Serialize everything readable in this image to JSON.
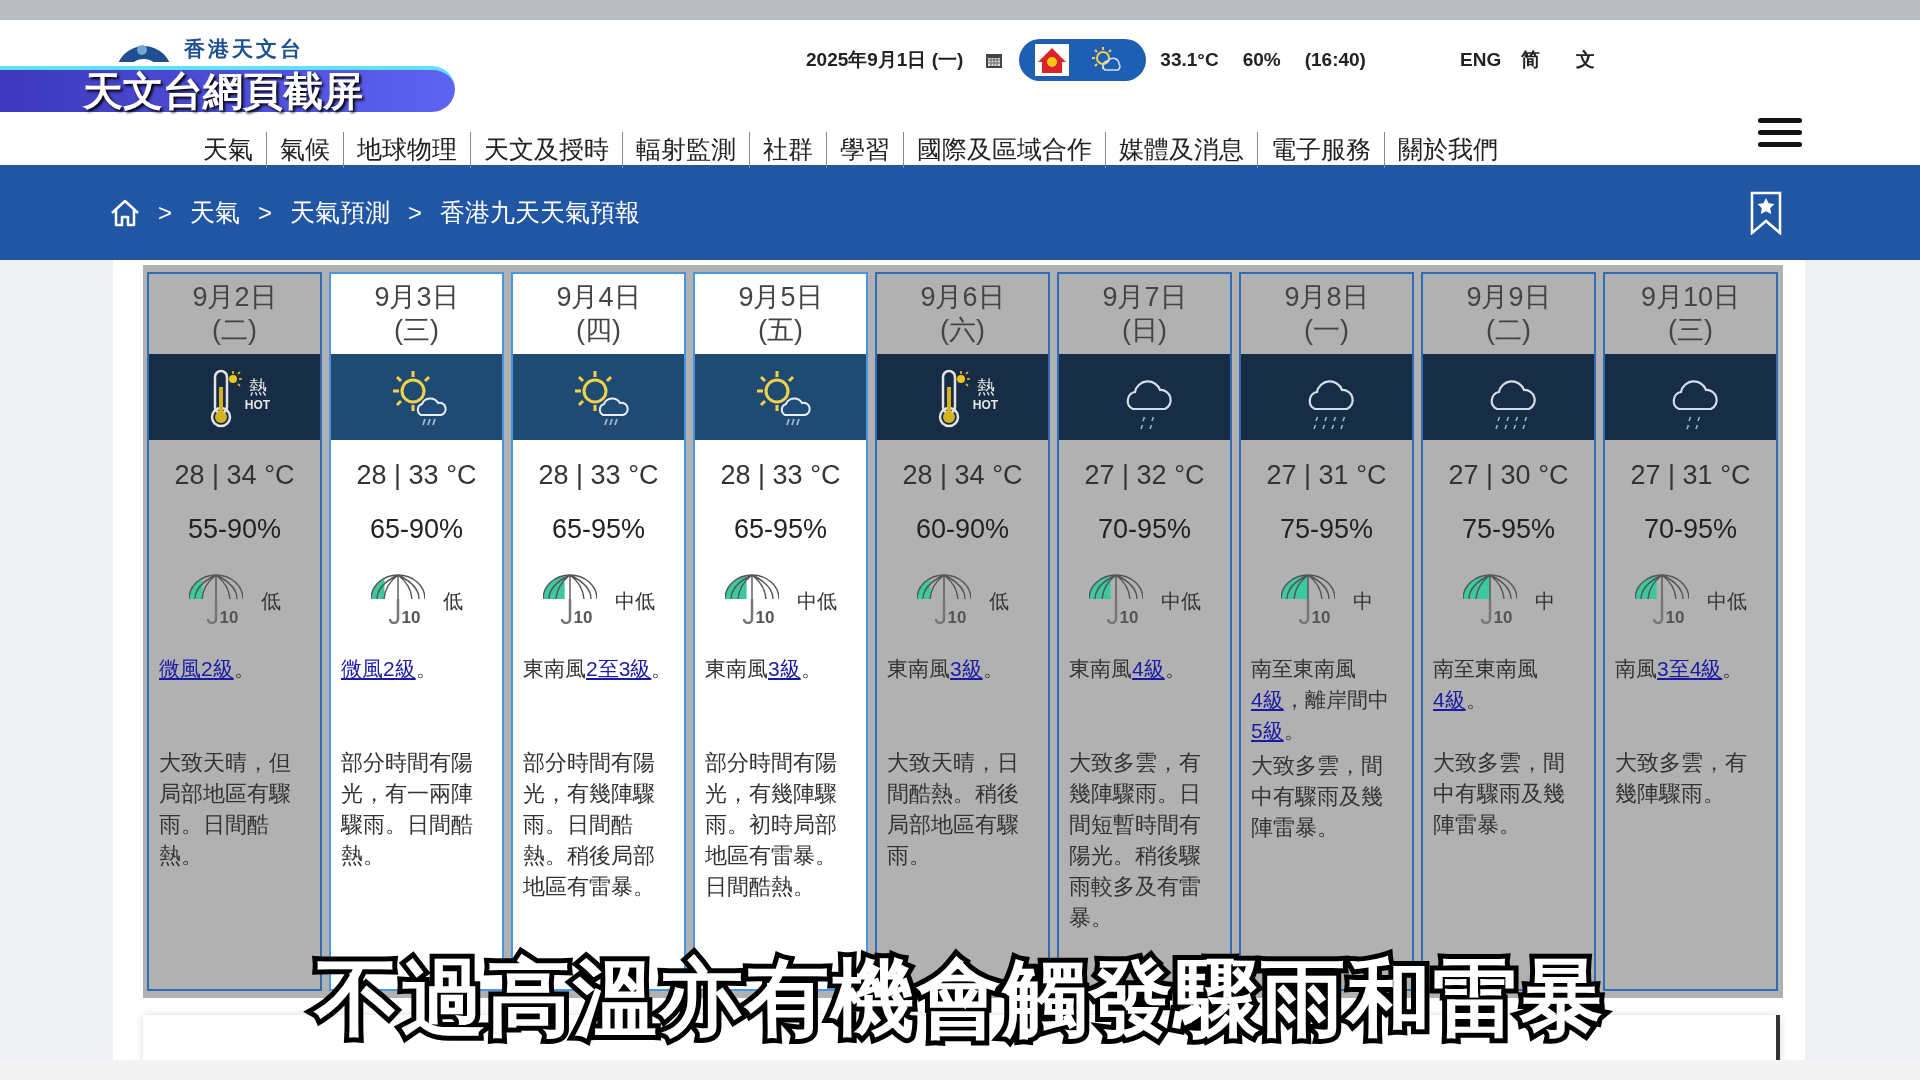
{
  "header": {
    "logo_text": "香港天文台",
    "date": "2025年9月1日 (一)",
    "temperature": "33.1°C",
    "humidity": "60%",
    "time": "(16:40)",
    "languages": [
      "ENG",
      "简",
      "文"
    ]
  },
  "nav": [
    "天氣",
    "氣候",
    "地球物理",
    "天文及授時",
    "輻射監測",
    "社群",
    "學習",
    "國際及區域合作",
    "媒體及消息",
    "電子服務",
    "關於我們"
  ],
  "breadcrumb": [
    {
      "kind": "home"
    },
    {
      "kind": "sep",
      "text": ">"
    },
    {
      "kind": "link",
      "text": "天氣"
    },
    {
      "kind": "sep",
      "text": ">"
    },
    {
      "kind": "link",
      "text": "天氣預測"
    },
    {
      "kind": "sep",
      "text": ">"
    },
    {
      "kind": "link",
      "text": "香港九天天氣預報"
    }
  ],
  "forecast": [
    {
      "date": "9月2日",
      "weekday": "(二)",
      "highlighted": false,
      "icon": {
        "kind": "hot",
        "label": "熱",
        "label_en": "HOT"
      },
      "temperature": "28 | 34 °C",
      "humidity": "55-90%",
      "psr": {
        "level": 0.25,
        "number": "10",
        "label": "低"
      },
      "wind": [
        {
          "text": "微風2級",
          "link": true
        },
        {
          "text": "。",
          "link": false
        }
      ],
      "description": "大致天晴，但局部地區有驟雨。日間酷熱。"
    },
    {
      "date": "9月3日",
      "weekday": "(三)",
      "highlighted": true,
      "icon": {
        "kind": "sun-shower"
      },
      "temperature": "28 | 33 °C",
      "humidity": "65-90%",
      "psr": {
        "level": 0.25,
        "number": "10",
        "label": "低"
      },
      "wind": [
        {
          "text": "微風2級",
          "link": true
        },
        {
          "text": "。",
          "link": false
        }
      ],
      "description": "部分時間有陽光，有一兩陣驟雨。日間酷熱。"
    },
    {
      "date": "9月4日",
      "weekday": "(四)",
      "highlighted": true,
      "icon": {
        "kind": "sun-shower"
      },
      "temperature": "28 | 33 °C",
      "humidity": "65-95%",
      "psr": {
        "level": 0.4,
        "number": "10",
        "label": "中低"
      },
      "wind": [
        {
          "text": "東南風",
          "link": false
        },
        {
          "text": "2至3級",
          "link": true
        },
        {
          "text": "。",
          "link": false
        }
      ],
      "description": "部分時間有陽光，有幾陣驟雨。日間酷熱。稍後局部地區有雷暴。"
    },
    {
      "date": "9月5日",
      "weekday": "(五)",
      "highlighted": true,
      "icon": {
        "kind": "sun-shower"
      },
      "temperature": "28 | 33 °C",
      "humidity": "65-95%",
      "psr": {
        "level": 0.4,
        "number": "10",
        "label": "中低"
      },
      "wind": [
        {
          "text": "東南風",
          "link": false
        },
        {
          "text": "3級",
          "link": true
        },
        {
          "text": "。",
          "link": false
        }
      ],
      "description": "部分時間有陽光，有幾陣驟雨。初時局部地區有雷暴。日間酷熱。"
    },
    {
      "date": "9月6日",
      "weekday": "(六)",
      "highlighted": false,
      "icon": {
        "kind": "hot",
        "label": "熱",
        "label_en": "HOT"
      },
      "temperature": "28 | 34 °C",
      "humidity": "60-90%",
      "psr": {
        "level": 0.25,
        "number": "10",
        "label": "低"
      },
      "wind": [
        {
          "text": "東南風",
          "link": false
        },
        {
          "text": "3級",
          "link": true
        },
        {
          "text": "。",
          "link": false
        }
      ],
      "description": "大致天晴，日間酷熱。稍後局部地區有驟雨。"
    },
    {
      "date": "9月7日",
      "weekday": "(日)",
      "highlighted": false,
      "icon": {
        "kind": "showers"
      },
      "temperature": "27 | 32 °C",
      "humidity": "70-95%",
      "psr": {
        "level": 0.4,
        "number": "10",
        "label": "中低"
      },
      "wind": [
        {
          "text": "東南風",
          "link": false
        },
        {
          "text": "4級",
          "link": true
        },
        {
          "text": "。",
          "link": false
        }
      ],
      "description": "大致多雲，有幾陣驟雨。日間短暫時間有陽光。稍後驟雨較多及有雷暴。"
    },
    {
      "date": "9月8日",
      "weekday": "(一)",
      "highlighted": false,
      "icon": {
        "kind": "heavy-showers"
      },
      "temperature": "27 | 31 °C",
      "humidity": "75-95%",
      "psr": {
        "level": 0.5,
        "number": "10",
        "label": "中"
      },
      "wind": [
        {
          "text": "南至東南風",
          "link": false
        },
        {
          "text": "4級",
          "link": true
        },
        {
          "text": "，離岸間中",
          "link": false
        },
        {
          "text": "5級",
          "link": true
        },
        {
          "text": "。",
          "link": false
        }
      ],
      "description": "大致多雲，間中有驟雨及幾陣雷暴。"
    },
    {
      "date": "9月9日",
      "weekday": "(二)",
      "highlighted": false,
      "icon": {
        "kind": "heavy-showers"
      },
      "temperature": "27 | 30 °C",
      "humidity": "75-95%",
      "psr": {
        "level": 0.5,
        "number": "10",
        "label": "中"
      },
      "wind": [
        {
          "text": "南至東南風",
          "link": false
        },
        {
          "text": "4級",
          "link": true
        },
        {
          "text": "。",
          "link": false
        }
      ],
      "description": "大致多雲，間中有驟雨及幾陣雷暴。"
    },
    {
      "date": "9月10日",
      "weekday": "(三)",
      "highlighted": false,
      "icon": {
        "kind": "showers"
      },
      "temperature": "27 | 31 °C",
      "humidity": "70-95%",
      "psr": {
        "level": 0.4,
        "number": "10",
        "label": "中低"
      },
      "wind": [
        {
          "text": "南風",
          "link": false
        },
        {
          "text": "3至4級",
          "link": true
        },
        {
          "text": "。",
          "link": false
        }
      ],
      "description": "大致多雲，有幾陣驟雨。"
    }
  ],
  "overlay": {
    "label": "天文台網頁截屏",
    "subtitle": "不過高溫亦有機會觸發驟雨和雷暴"
  }
}
